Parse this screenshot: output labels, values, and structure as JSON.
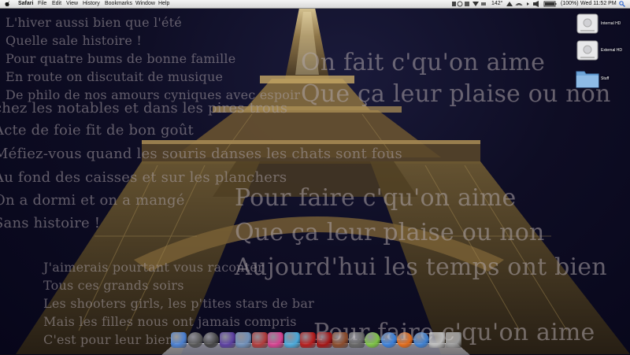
{
  "menubar": {
    "app_name": "Safari",
    "menus": [
      "File",
      "Edit",
      "View",
      "History",
      "Bookmarks",
      "Window",
      "Help"
    ],
    "status": {
      "temperature": "142°",
      "battery": "(100%)",
      "clock": "Wed 11:52 PM"
    }
  },
  "desktop_icons": [
    {
      "label": "Internal HD",
      "icon": "hard-drive-icon"
    },
    {
      "label": "External HD",
      "icon": "hard-drive-icon"
    },
    {
      "label": "Stuff",
      "icon": "folder-icon"
    }
  ],
  "wallpaper": {
    "lyrics_left": [
      "L'hiver aussi bien que l'été",
      "Quelle sale histoire !",
      "Pour quatre bums de bonne famille",
      "En route on discutait de musique",
      "De philo de nos amours cyniques avec espoir",
      "chez les notables et dans les pires trous",
      "Acte de foie fit de bon goût",
      "Méfiez-vous quand les souris danses les chats sont fous",
      "Au fond des caisses et sur les planchers",
      "On a dormi et on a mangé",
      "Sans histoire !"
    ],
    "lyrics_bottom_left": [
      "J'aimerais pourtant vous raconter",
      "Tous ces grands soirs",
      "Les shooters girls, les p'tites stars de bar",
      "Mais les filles nous ont jamais compris",
      "C'est pour leur bien"
    ],
    "lyrics_large": [
      "On fait c'qu'on aime",
      "Que ça leur plaise ou non",
      "Pour faire c'qu'on aime",
      "Que ça leur plaise ou non",
      "Aujourd'hui les temps ont bien",
      "Pour faire c'qu'on aime"
    ]
  },
  "dock": {
    "apps": [
      {
        "name": "finder-icon",
        "color": "#4a7fd0"
      },
      {
        "name": "dashboard-icon",
        "color": "#555555"
      },
      {
        "name": "safari-compass-icon",
        "color": "#444444"
      },
      {
        "name": "wizard-icon",
        "color": "#5b3fa0"
      },
      {
        "name": "preview-icon",
        "color": "#6f8fb8"
      },
      {
        "name": "photo-booth-icon",
        "color": "#b03b3b"
      },
      {
        "name": "flower-icon",
        "color": "#d4418f"
      },
      {
        "name": "fish-icon",
        "color": "#4aa8d8"
      },
      {
        "name": "red-app-icon",
        "color": "#b51d1d"
      },
      {
        "name": "book-icon",
        "color": "#a31515"
      },
      {
        "name": "photos-icon",
        "color": "#8a4a2a"
      },
      {
        "name": "settings-icon",
        "color": "#666666"
      },
      {
        "name": "green-app-icon",
        "color": "#7bc043"
      },
      {
        "name": "itunes-icon",
        "color": "#3a7fd8"
      },
      {
        "name": "firefox-icon",
        "color": "#e06a1a"
      },
      {
        "name": "mail-icon",
        "color": "#3d7fcf"
      },
      {
        "name": "documents-icon",
        "color": "#bbbbbb"
      },
      {
        "name": "trash-icon",
        "color": "#9a9a9a"
      }
    ]
  }
}
